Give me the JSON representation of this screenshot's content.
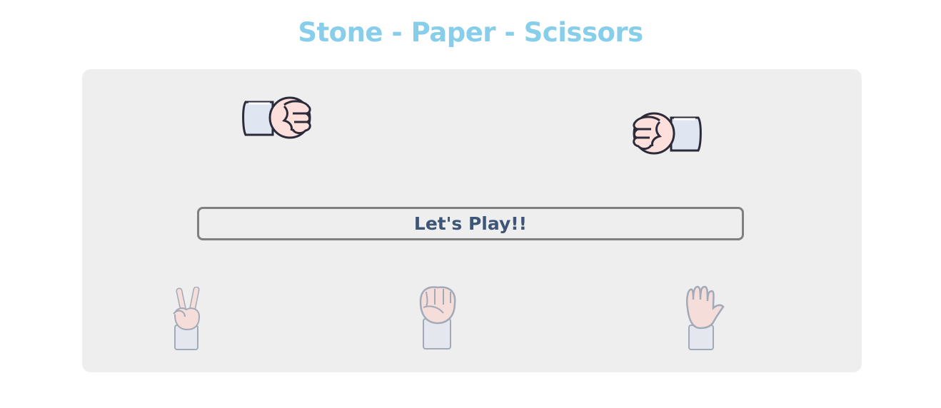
{
  "game": {
    "title": "Stone - Paper - Scissors",
    "play_button_label": "Let's Play!!"
  },
  "hands": {
    "player_left": "fist-icon",
    "computer_right": "fist-icon"
  },
  "choices": [
    {
      "name": "scissors",
      "icon": "scissors-hand-icon"
    },
    {
      "name": "stone",
      "icon": "stone-hand-icon"
    },
    {
      "name": "paper",
      "icon": "paper-hand-icon"
    }
  ],
  "colors": {
    "title": "#87ceeb",
    "board_bg": "#eeeeee",
    "button_text": "#3d5576",
    "button_border": "#7f7f7f",
    "skin": "#fde0dc",
    "sleeve": "#dfe6f2",
    "outline": "#2b2b3a"
  }
}
